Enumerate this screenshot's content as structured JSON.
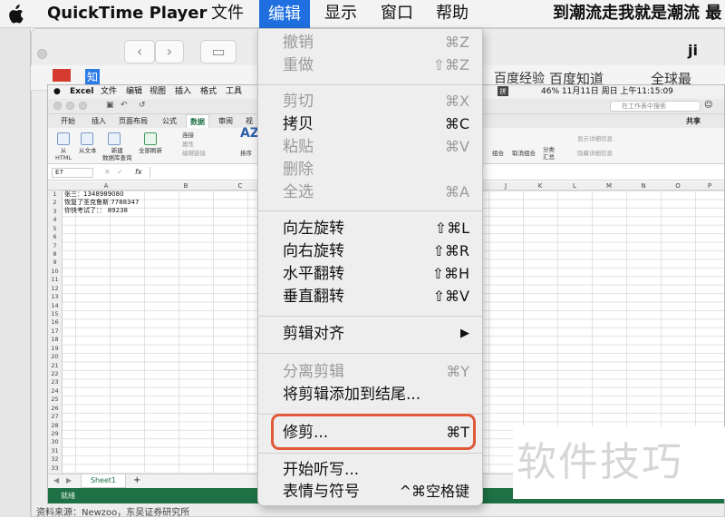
{
  "menubar": {
    "app_name": "QuickTime Player",
    "items": [
      "文件",
      "编辑",
      "显示",
      "窗口",
      "帮助"
    ],
    "marquee": "到潮流走我就是潮流 最"
  },
  "browser": {
    "url_fragment": "ji",
    "bookmarks": [
      "知",
      "百度经验",
      "百度知道",
      "全球最"
    ]
  },
  "excel": {
    "menu": [
      "Excel",
      "文件",
      "编辑",
      "视图",
      "插入",
      "格式",
      "工具"
    ],
    "status_right": "46%  11月11日 周日 上午11:15:09",
    "search_placeholder": "在工作表中搜索",
    "share_label": "共享",
    "tabs": [
      "开始",
      "插入",
      "页面布局",
      "公式",
      "数据",
      "审阅",
      "视"
    ],
    "active_tab": "数据",
    "ribbon": {
      "from_html": "从\nHTML",
      "from_text": "从文本",
      "new_db_query": "新建\n数据库查询",
      "refresh_all": "全部刷新",
      "connections": "连接",
      "properties": "属性",
      "edit_links": "编辑链接",
      "sort": "排序",
      "group": "组合",
      "ungroup": "取消组合",
      "subtotal": "分类\n汇总",
      "show_detail": "显示详细信息",
      "hide_detail": "隐藏详细信息"
    },
    "name_box": "E7",
    "fx": "fx",
    "columns": [
      "A",
      "B",
      "C",
      "J",
      "K",
      "L",
      "M",
      "N",
      "O",
      "P"
    ],
    "rows": [
      "1",
      "2",
      "3",
      "4",
      "5",
      "6",
      "7",
      "8",
      "9",
      "10",
      "11",
      "12",
      "13",
      "14",
      "15",
      "16",
      "17",
      "18",
      "19",
      "20",
      "21",
      "22",
      "23",
      "24",
      "25",
      "26",
      "27",
      "28",
      "29",
      "30",
      "31",
      "32",
      "33"
    ],
    "cells": [
      "张三：1348989080",
      "恢复了圣克鲁斯 7788347",
      "你快考试了：： 89238"
    ],
    "sheet_tab": "Sheet1",
    "add_sheet": "+",
    "status": "就绪"
  },
  "dropdown": {
    "undo": {
      "label": "撤销",
      "shortcut": "⌘Z"
    },
    "redo": {
      "label": "重做",
      "shortcut": "⇧⌘Z"
    },
    "cut": {
      "label": "剪切",
      "shortcut": "⌘X"
    },
    "copy": {
      "label": "拷贝",
      "shortcut": "⌘C"
    },
    "paste": {
      "label": "粘贴",
      "shortcut": "⌘V"
    },
    "delete": {
      "label": "删除",
      "shortcut": ""
    },
    "select_all": {
      "label": "全选",
      "shortcut": "⌘A"
    },
    "rotate_left": {
      "label": "向左旋转",
      "shortcut": "⇧⌘L"
    },
    "rotate_right": {
      "label": "向右旋转",
      "shortcut": "⇧⌘R"
    },
    "flip_h": {
      "label": "水平翻转",
      "shortcut": "⇧⌘H"
    },
    "flip_v": {
      "label": "垂直翻转",
      "shortcut": "⇧⌘V"
    },
    "align_clip": {
      "label": "剪辑对齐",
      "shortcut": "▶"
    },
    "split_clip": {
      "label": "分离剪辑",
      "shortcut": "⌘Y"
    },
    "add_clip_end": {
      "label": "将剪辑添加到结尾...",
      "shortcut": ""
    },
    "trim": {
      "label": "修剪...",
      "shortcut": "⌘T"
    },
    "dictation": {
      "label": "开始听写...",
      "shortcut": ""
    },
    "emoji": {
      "label": "表情与符号",
      "shortcut": "^⌘空格键"
    }
  },
  "watermark": "软件技巧",
  "source_note": "资料来源：Newzoo，东吴证券研究所",
  "colors": {
    "menu_highlight": "#1f6fe0",
    "excel_green": "#1e7145",
    "trim_box": "#e05a3a"
  }
}
